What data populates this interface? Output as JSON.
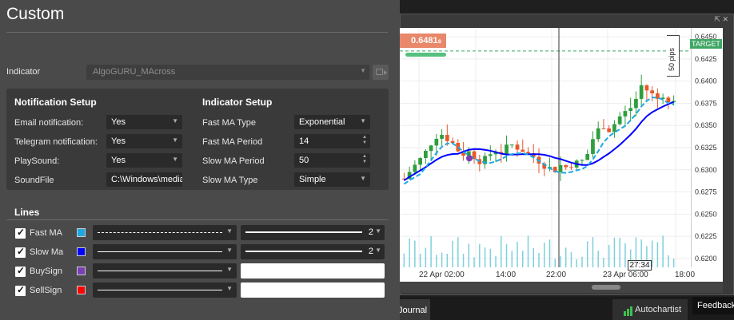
{
  "dialog": {
    "title": "Custom",
    "indicator_label": "Indicator",
    "indicator_value": "AlgoGURU_MAcross",
    "notification": {
      "heading": "Notification Setup",
      "rows": [
        {
          "label": "Email notification:",
          "value": "Yes"
        },
        {
          "label": "Telegram notification:",
          "value": "Yes"
        },
        {
          "label": "PlaySound:",
          "value": "Yes"
        },
        {
          "label": "SoundFile",
          "value": "C:\\Windows\\media\\"
        }
      ]
    },
    "indicator_setup": {
      "heading": "Indicator Setup",
      "rows": [
        {
          "label": "Fast MA Type",
          "value": "Exponential"
        },
        {
          "label": "Fast MA Period",
          "value": "14"
        },
        {
          "label": "Slow MA Period",
          "value": "50"
        },
        {
          "label": "Slow MA Type",
          "value": "Simple"
        }
      ]
    },
    "lines": {
      "heading": "Lines",
      "items": [
        {
          "label": "Fast MA",
          "color": "#1ea7e1",
          "style": "dashed",
          "thickness": "2"
        },
        {
          "label": "Slow Ma",
          "color": "#0000ff",
          "style": "solid",
          "thickness": "2"
        },
        {
          "label": "BuySign",
          "color": "#7b3fb5",
          "style": "solid",
          "thickness": ""
        },
        {
          "label": "SellSign",
          "color": "#ff0000",
          "style": "solid",
          "thickness": ""
        }
      ]
    }
  },
  "chart": {
    "price_tag": "0.6481",
    "price_tag_suffix": "s",
    "target_label": "TARGET",
    "pips_label": "50 pips",
    "y_ticks": [
      "0.6450",
      "0.6425",
      "0.6400",
      "0.6375",
      "0.6350",
      "0.6325",
      "0.6300",
      "0.6275",
      "0.6250",
      "0.6225",
      "0.6200"
    ],
    "x_ticks": [
      "22 Apr 02:00",
      "14:00",
      "22:00",
      "23 Apr 06:00",
      "18:00"
    ],
    "cursor_time": "27:34"
  },
  "bottom": {
    "journal_tab": "Journal",
    "autochartist": "Autochartist",
    "feedback": "Feedback"
  },
  "chart_data": {
    "type": "candlestick",
    "y_range": [
      0.619,
      0.646
    ],
    "fast_ma_color": "#1ea7e1",
    "slow_ma_color": "#0000ff",
    "bullish_color": "#2e9e3e",
    "bearish_color": "#e8582a"
  }
}
